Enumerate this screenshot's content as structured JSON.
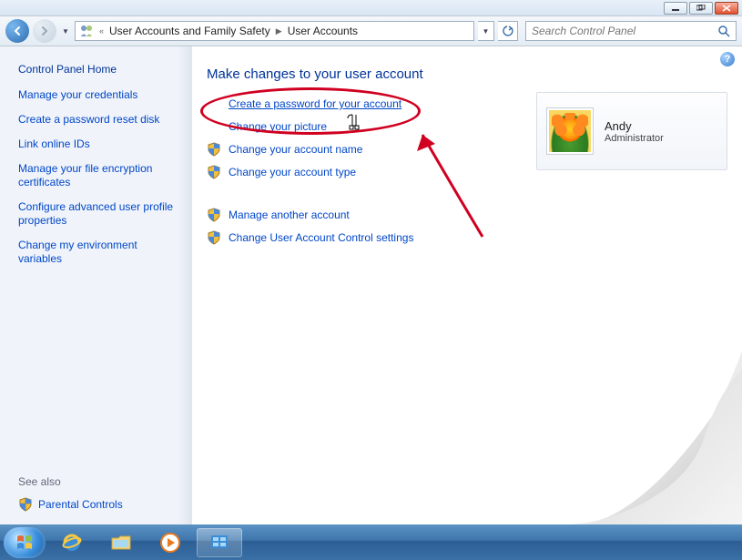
{
  "titlebar": {
    "min": "—",
    "max": "❐",
    "close": "X"
  },
  "nav": {
    "crumb1": "User Accounts and Family Safety",
    "crumb2": "User Accounts",
    "search_placeholder": "Search Control Panel"
  },
  "sidebar": {
    "home": "Control Panel Home",
    "links": [
      "Manage your credentials",
      "Create a password reset disk",
      "Link online IDs",
      "Manage your file encryption certificates",
      "Configure advanced user profile properties",
      "Change my environment variables"
    ],
    "seealso_hdr": "See also",
    "seealso_link": "Parental Controls"
  },
  "main": {
    "heading": "Make changes to your user account",
    "tasks1": [
      {
        "label": "Create a password for your account",
        "shield": false,
        "ul": true
      },
      {
        "label": "Change your picture",
        "shield": false
      },
      {
        "label": "Change your account name",
        "shield": true
      },
      {
        "label": "Change your account type",
        "shield": true
      }
    ],
    "tasks2": [
      {
        "label": "Manage another account",
        "shield": true
      },
      {
        "label": "Change User Account Control settings",
        "shield": true
      }
    ]
  },
  "user": {
    "name": "Andy",
    "role": "Administrator"
  },
  "taskbar": {}
}
